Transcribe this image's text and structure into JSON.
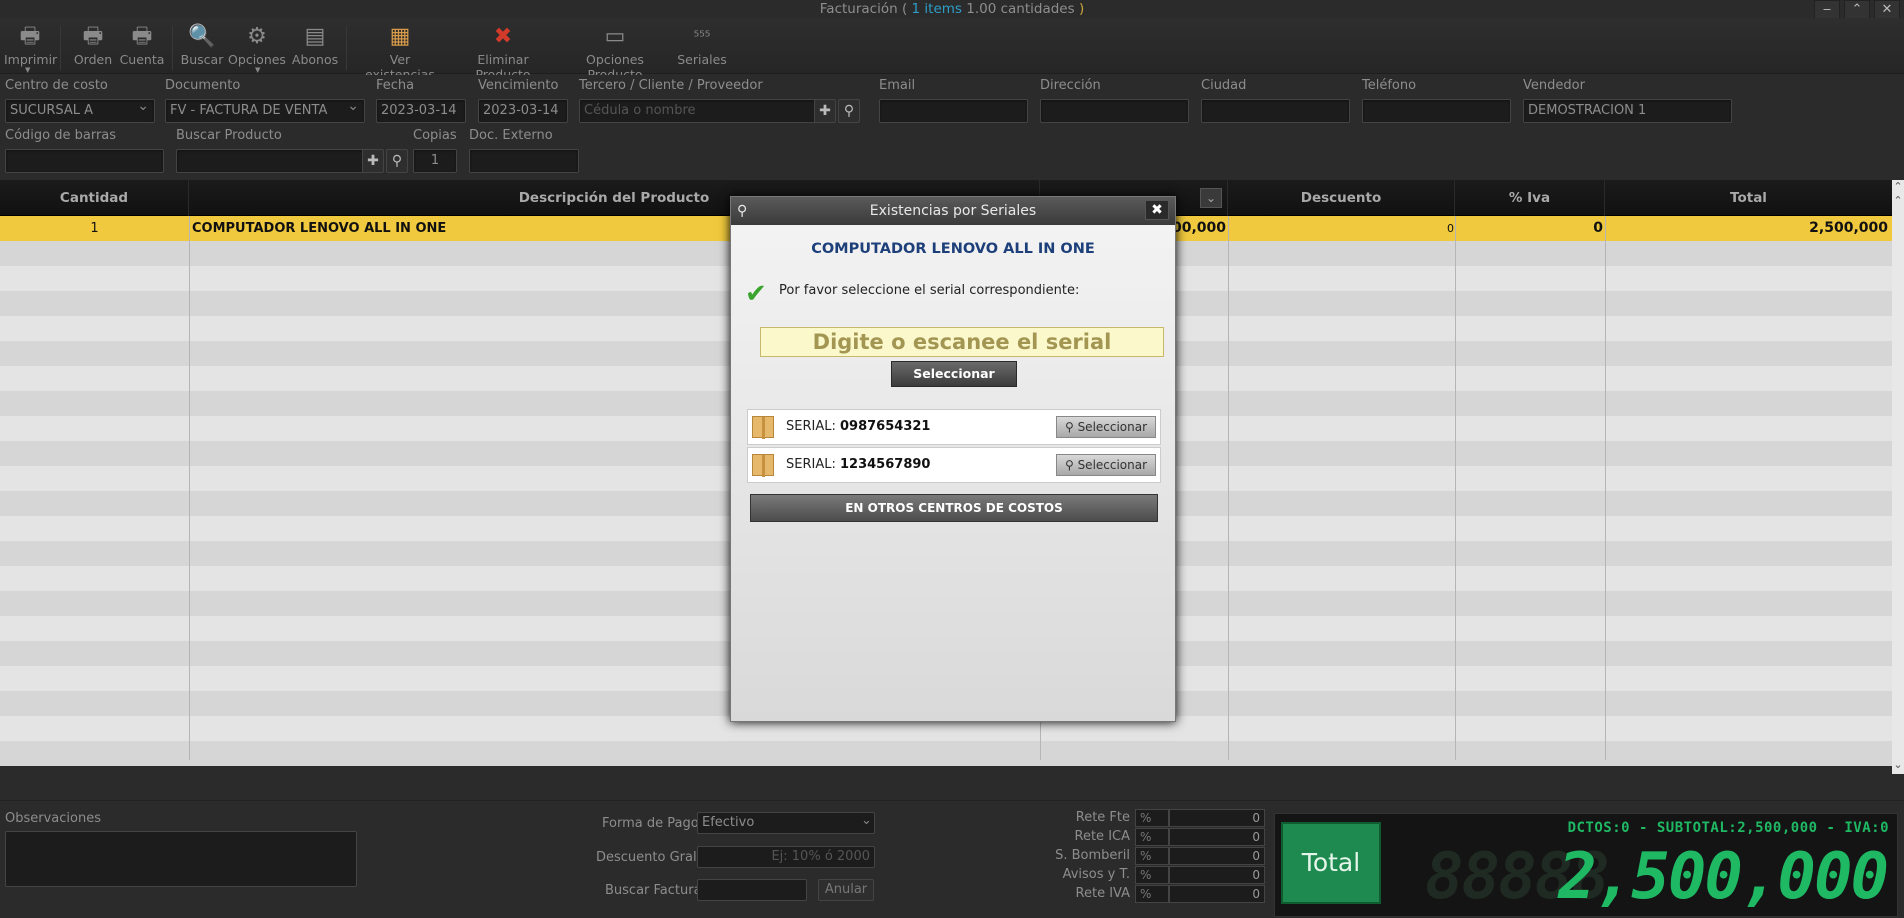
{
  "title": {
    "prefix": "Facturación (",
    "items": "1 items",
    "qty": "1.00 cantidades",
    "suffix": ")"
  },
  "window": {
    "minimize": "‒",
    "maximize": "⌃",
    "close": "✕"
  },
  "toolbar": {
    "imprimir": "Imprimir",
    "orden": "Orden",
    "cuenta": "Cuenta",
    "buscar": "Buscar",
    "opciones": "Opciones",
    "abonos": "Abonos",
    "ver_existencias": "Ver existencias",
    "eliminar_producto": "Eliminar Producto",
    "opciones_producto": "Opciones Producto",
    "seriales": "Seriales"
  },
  "form": {
    "centro_costo_label": "Centro de costo",
    "centro_costo_value": "SUCURSAL A",
    "documento_label": "Documento",
    "documento_value": "FV - FACTURA DE VENTA",
    "fecha_label": "Fecha",
    "fecha_value": "2023-03-14",
    "vencimiento_label": "Vencimiento",
    "vencimiento_value": "2023-03-14",
    "tercero_label": "Tercero / Cliente / Proveedor",
    "tercero_placeholder": "Cédula o nombre",
    "email_label": "Email",
    "direccion_label": "Dirección",
    "ciudad_label": "Ciudad",
    "telefono_label": "Teléfono",
    "vendedor_label": "Vendedor",
    "vendedor_value": "DEMOSTRACION 1",
    "codigo_barras_label": "Código de barras",
    "buscar_producto_label": "Buscar Producto",
    "copias_label": "Copias",
    "copias_value": "1",
    "doc_externo_label": "Doc. Externo"
  },
  "grid": {
    "headers": {
      "cantidad": "Cantidad",
      "descripcion": "Descripción del Producto",
      "descuento": "Descuento",
      "iva": "% Iva",
      "total": "Total"
    },
    "rows": [
      {
        "cantidad": "1",
        "descripcion": "COMPUTADOR LENOVO ALL IN ONE",
        "valor": "00,000",
        "descuento": "0",
        "iva": "0",
        "total": "2,500,000"
      }
    ]
  },
  "modal": {
    "title": "Existencias por Seriales",
    "close": "✖",
    "product": "COMPUTADOR LENOVO ALL IN ONE",
    "instruction": "Por favor seleccione el serial correspondiente:",
    "input_placeholder": "Digite o escanee el serial",
    "select_button": "Seleccionar",
    "serial_prefix": "SERIAL:",
    "serials": [
      {
        "value": "0987654321",
        "button": "Seleccionar"
      },
      {
        "value": "1234567890",
        "button": "Seleccionar"
      }
    ],
    "otros_button": "EN OTROS CENTROS DE COSTOS"
  },
  "bottom": {
    "observaciones_label": "Observaciones",
    "forma_pago_label": "Forma de Pago",
    "forma_pago_value": "Efectivo",
    "descuento_gral_label": "Descuento Gral.",
    "descuento_gral_placeholder": "Ej: 10% ó 2000",
    "buscar_factura_label": "Buscar Factura",
    "anular_button": "Anular",
    "retenciones": [
      {
        "label": "Rete Fte",
        "pct": "%",
        "value": "0"
      },
      {
        "label": "Rete ICA",
        "pct": "%",
        "value": "0"
      },
      {
        "label": "S. Bomberil",
        "pct": "%",
        "value": "0"
      },
      {
        "label": "Avisos y T.",
        "pct": "%",
        "value": "0"
      },
      {
        "label": "Rete IVA",
        "pct": "%",
        "value": "0"
      }
    ],
    "total_button": "Total",
    "summary": "DCTOS:0 - SUBTOTAL:2,500,000 - IVA:0",
    "total_value": "2,500,000",
    "total_ghost": "88888"
  },
  "colors": {
    "accent_green": "#1fb964",
    "selected_row": "#f0c93e",
    "title_blue": "#1d3f7a"
  }
}
